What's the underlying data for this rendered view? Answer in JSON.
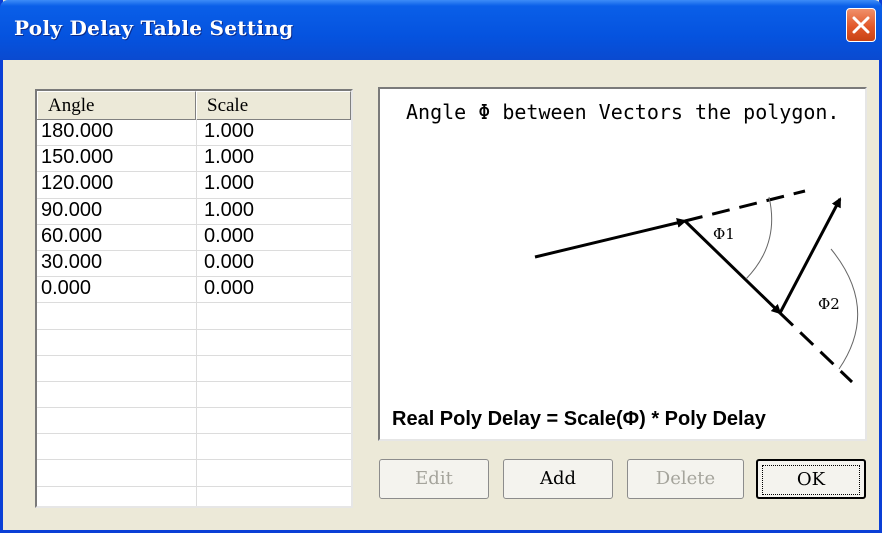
{
  "window": {
    "title": "Poly Delay Table Setting",
    "close_icon": "close-icon"
  },
  "table": {
    "columns": [
      "Angle",
      "Scale"
    ],
    "rows": [
      {
        "angle": "180.000",
        "scale": "1.000"
      },
      {
        "angle": "150.000",
        "scale": "1.000"
      },
      {
        "angle": "120.000",
        "scale": "1.000"
      },
      {
        "angle": "90.000",
        "scale": "1.000"
      },
      {
        "angle": "60.000",
        "scale": "0.000"
      },
      {
        "angle": "30.000",
        "scale": "0.000"
      },
      {
        "angle": "0.000",
        "scale": "0.000"
      }
    ]
  },
  "preview": {
    "description": "Angle Φ between Vectors the polygon.",
    "phi1_label": "Φ1",
    "phi2_label": "Φ2",
    "formula": "Real Poly Delay  = Scale(Φ) * Poly Delay"
  },
  "buttons": {
    "edit": "Edit",
    "add": "Add",
    "delete": "Delete",
    "ok": "OK"
  },
  "colors": {
    "titlebar": "#0553df",
    "window_bg": "#ece9d8",
    "close_button": "#e2582a",
    "disabled_text": "#a5a49c"
  }
}
